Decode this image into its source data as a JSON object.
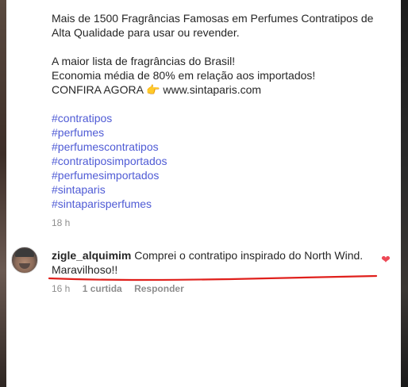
{
  "caption": {
    "line1": "Mais de 1500 Fragrâncias Famosas em Perfumes Contratipos de",
    "line2": "Alta Qualidade para usar ou revender.",
    "line3": "A maior lista de fragrâncias do Brasil!",
    "line4": "Economia média de 80% em relação aos importados!",
    "cta_text": "CONFIRA AGORA",
    "cta_icon": "👉",
    "cta_link": "www.sintaparis.com"
  },
  "hashtags": [
    "#contratipos",
    "#perfumes",
    "#perfumescontratipos",
    "#contratiposimportados",
    "#perfumesimportados",
    "#sintaparis",
    "#sintaparisperfumes"
  ],
  "post_time": "18 h",
  "comment": {
    "username": "zigle_alquimim",
    "text": "Comprei o contratipo inspirado do North Wind. Maravilhoso!!",
    "time": "16 h",
    "likes": "1 curtida",
    "reply": "Responder",
    "like_icon": "heart-icon",
    "like_color": "#ed4956"
  },
  "annotation_color": "#e0201c"
}
